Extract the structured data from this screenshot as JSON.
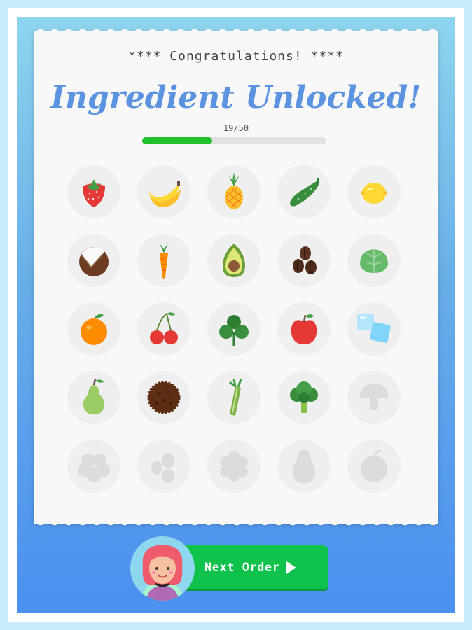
{
  "header": {
    "congrats": "**** Congratulations! ****",
    "title": "Ingredient Unlocked!"
  },
  "progress": {
    "label": "19/50",
    "current": 19,
    "total": 50
  },
  "ingredients": [
    {
      "name": "strawberry",
      "unlocked": true
    },
    {
      "name": "banana",
      "unlocked": true
    },
    {
      "name": "pineapple",
      "unlocked": true
    },
    {
      "name": "cucumber",
      "unlocked": true
    },
    {
      "name": "lemon",
      "unlocked": true
    },
    {
      "name": "coconut",
      "unlocked": true
    },
    {
      "name": "carrot",
      "unlocked": true
    },
    {
      "name": "avocado",
      "unlocked": true
    },
    {
      "name": "coffee-beans",
      "unlocked": true
    },
    {
      "name": "lettuce",
      "unlocked": true
    },
    {
      "name": "orange",
      "unlocked": true
    },
    {
      "name": "cherries",
      "unlocked": true
    },
    {
      "name": "clover",
      "unlocked": true
    },
    {
      "name": "apple",
      "unlocked": true
    },
    {
      "name": "ice-cubes",
      "unlocked": true
    },
    {
      "name": "pear",
      "unlocked": true
    },
    {
      "name": "cookie",
      "unlocked": true
    },
    {
      "name": "celery",
      "unlocked": true
    },
    {
      "name": "broccoli",
      "unlocked": true
    },
    {
      "name": "mushroom",
      "unlocked": false
    },
    {
      "name": "locked-cluster",
      "unlocked": false
    },
    {
      "name": "locked-beans",
      "unlocked": false
    },
    {
      "name": "locked-blob",
      "unlocked": false
    },
    {
      "name": "locked-pear",
      "unlocked": false
    },
    {
      "name": "locked-round",
      "unlocked": false
    }
  ],
  "button": {
    "next_label": "Next Order"
  },
  "colors": {
    "accent_green": "#0ec24c",
    "title_blue": "#5b93e0",
    "progress_green": "#21c12d"
  }
}
